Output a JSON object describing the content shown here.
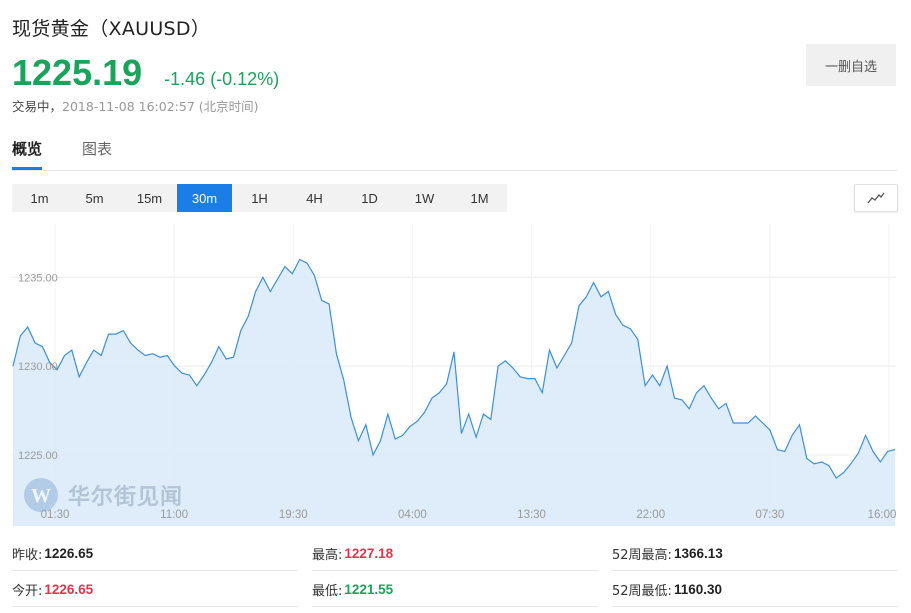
{
  "header": {
    "title": "现货黄金（XAUUSD）",
    "price": "1225.19",
    "change": "-1.46 (-0.12%)",
    "status": "交易中，",
    "timestamp": "2018-11-08 16:02:57 (北京时间)",
    "remove_watchlist_label": "一删自选"
  },
  "tabs": [
    {
      "label": "概览",
      "active": true
    },
    {
      "label": "图表",
      "active": false
    }
  ],
  "intervals": [
    {
      "label": "1m",
      "active": false
    },
    {
      "label": "5m",
      "active": false
    },
    {
      "label": "15m",
      "active": false
    },
    {
      "label": "30m",
      "active": true
    },
    {
      "label": "1H",
      "active": false
    },
    {
      "label": "4H",
      "active": false
    },
    {
      "label": "1D",
      "active": false
    },
    {
      "label": "1W",
      "active": false
    },
    {
      "label": "1M",
      "active": false
    }
  ],
  "chart_type_icon": "line-chart-icon",
  "watermark": {
    "text": "华尔街见闻",
    "icon": "wallstreetcn-logo-icon"
  },
  "colors": {
    "up": "#1aa35a",
    "down": "#e0354b",
    "accent": "#1a7ee6",
    "line": "#3d8fd9",
    "fill": "#dcebfa"
  },
  "chart_data": {
    "type": "area",
    "title": "",
    "xlabel": "",
    "ylabel": "",
    "ylim": [
      1221.0,
      1238.0
    ],
    "yticks": [
      "1235.00",
      "1230.00",
      "1225.00"
    ],
    "x_ticks": [
      "01:30",
      "11:00",
      "19:30",
      "04:00",
      "13:30",
      "22:00",
      "07:30",
      "16:00"
    ],
    "grid": true,
    "series": [
      {
        "values": [
          1230.0,
          1231.7,
          1232.2,
          1231.3,
          1231.1,
          1230.2,
          1229.8,
          1230.6,
          1230.9,
          1229.4,
          1230.2,
          1230.9,
          1230.6,
          1231.8,
          1231.8,
          1232.0,
          1231.3,
          1230.9,
          1230.6,
          1230.7,
          1230.5,
          1230.6,
          1230.0,
          1229.6,
          1229.5,
          1228.9,
          1229.5,
          1230.2,
          1231.1,
          1230.4,
          1230.5,
          1232.0,
          1232.8,
          1234.2,
          1235.0,
          1234.2,
          1234.9,
          1235.6,
          1235.2,
          1236.0,
          1235.8,
          1235.1,
          1233.7,
          1233.5,
          1230.7,
          1229.2,
          1227.1,
          1225.8,
          1226.7,
          1225.0,
          1225.8,
          1227.3,
          1225.9,
          1226.1,
          1226.6,
          1226.9,
          1227.4,
          1228.2,
          1228.5,
          1229.0,
          1230.8,
          1226.2,
          1227.3,
          1226.0,
          1227.3,
          1227.0,
          1230.0,
          1230.3,
          1229.9,
          1229.4,
          1229.3,
          1229.3,
          1228.5,
          1230.9,
          1229.9,
          1230.6,
          1231.3,
          1233.4,
          1233.9,
          1234.7,
          1233.9,
          1234.2,
          1232.9,
          1232.3,
          1232.1,
          1231.5,
          1228.9,
          1229.5,
          1228.9,
          1230.0,
          1228.2,
          1228.1,
          1227.6,
          1228.5,
          1228.9,
          1228.2,
          1227.6,
          1227.9,
          1226.8,
          1226.8,
          1226.8,
          1227.2,
          1226.8,
          1226.4,
          1225.3,
          1225.2,
          1226.1,
          1226.7,
          1224.8,
          1224.5,
          1224.6,
          1224.4,
          1223.7,
          1224.0,
          1224.5,
          1225.1,
          1226.1,
          1225.2,
          1224.6,
          1225.2,
          1225.3
        ]
      }
    ]
  },
  "stats": [
    {
      "label": "昨收:",
      "value": "1226.65",
      "tone": "neutral"
    },
    {
      "label": "最高:",
      "value": "1227.18",
      "tone": "red"
    },
    {
      "label": "52周最高:",
      "value": "1366.13",
      "tone": "neutral"
    },
    {
      "label": "今开:",
      "value": "1226.65",
      "tone": "red"
    },
    {
      "label": "最低:",
      "value": "1221.55",
      "tone": "green"
    },
    {
      "label": "52周最低:",
      "value": "1160.30",
      "tone": "neutral"
    }
  ]
}
